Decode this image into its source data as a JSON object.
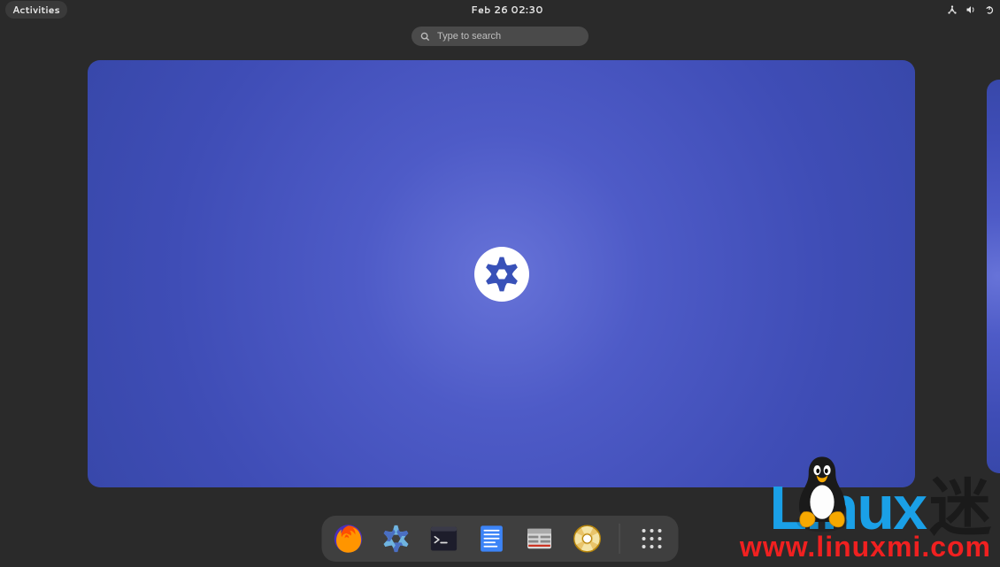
{
  "topbar": {
    "activities_label": "Activities",
    "clock": "Feb 26  02:30",
    "icons": [
      "network",
      "volume",
      "power"
    ]
  },
  "search": {
    "placeholder": "Type to search"
  },
  "workspace": {
    "logo": "nixos-snowflake"
  },
  "dock": {
    "items": [
      {
        "name": "firefox"
      },
      {
        "name": "nixos-settings"
      },
      {
        "name": "terminal"
      },
      {
        "name": "text-editor"
      },
      {
        "name": "nautilus-files"
      },
      {
        "name": "help"
      }
    ],
    "apps_button": "show-applications"
  },
  "watermark": {
    "brand_en": "Linux",
    "brand_cn": "迷",
    "url": "www.linuxmi.com"
  }
}
